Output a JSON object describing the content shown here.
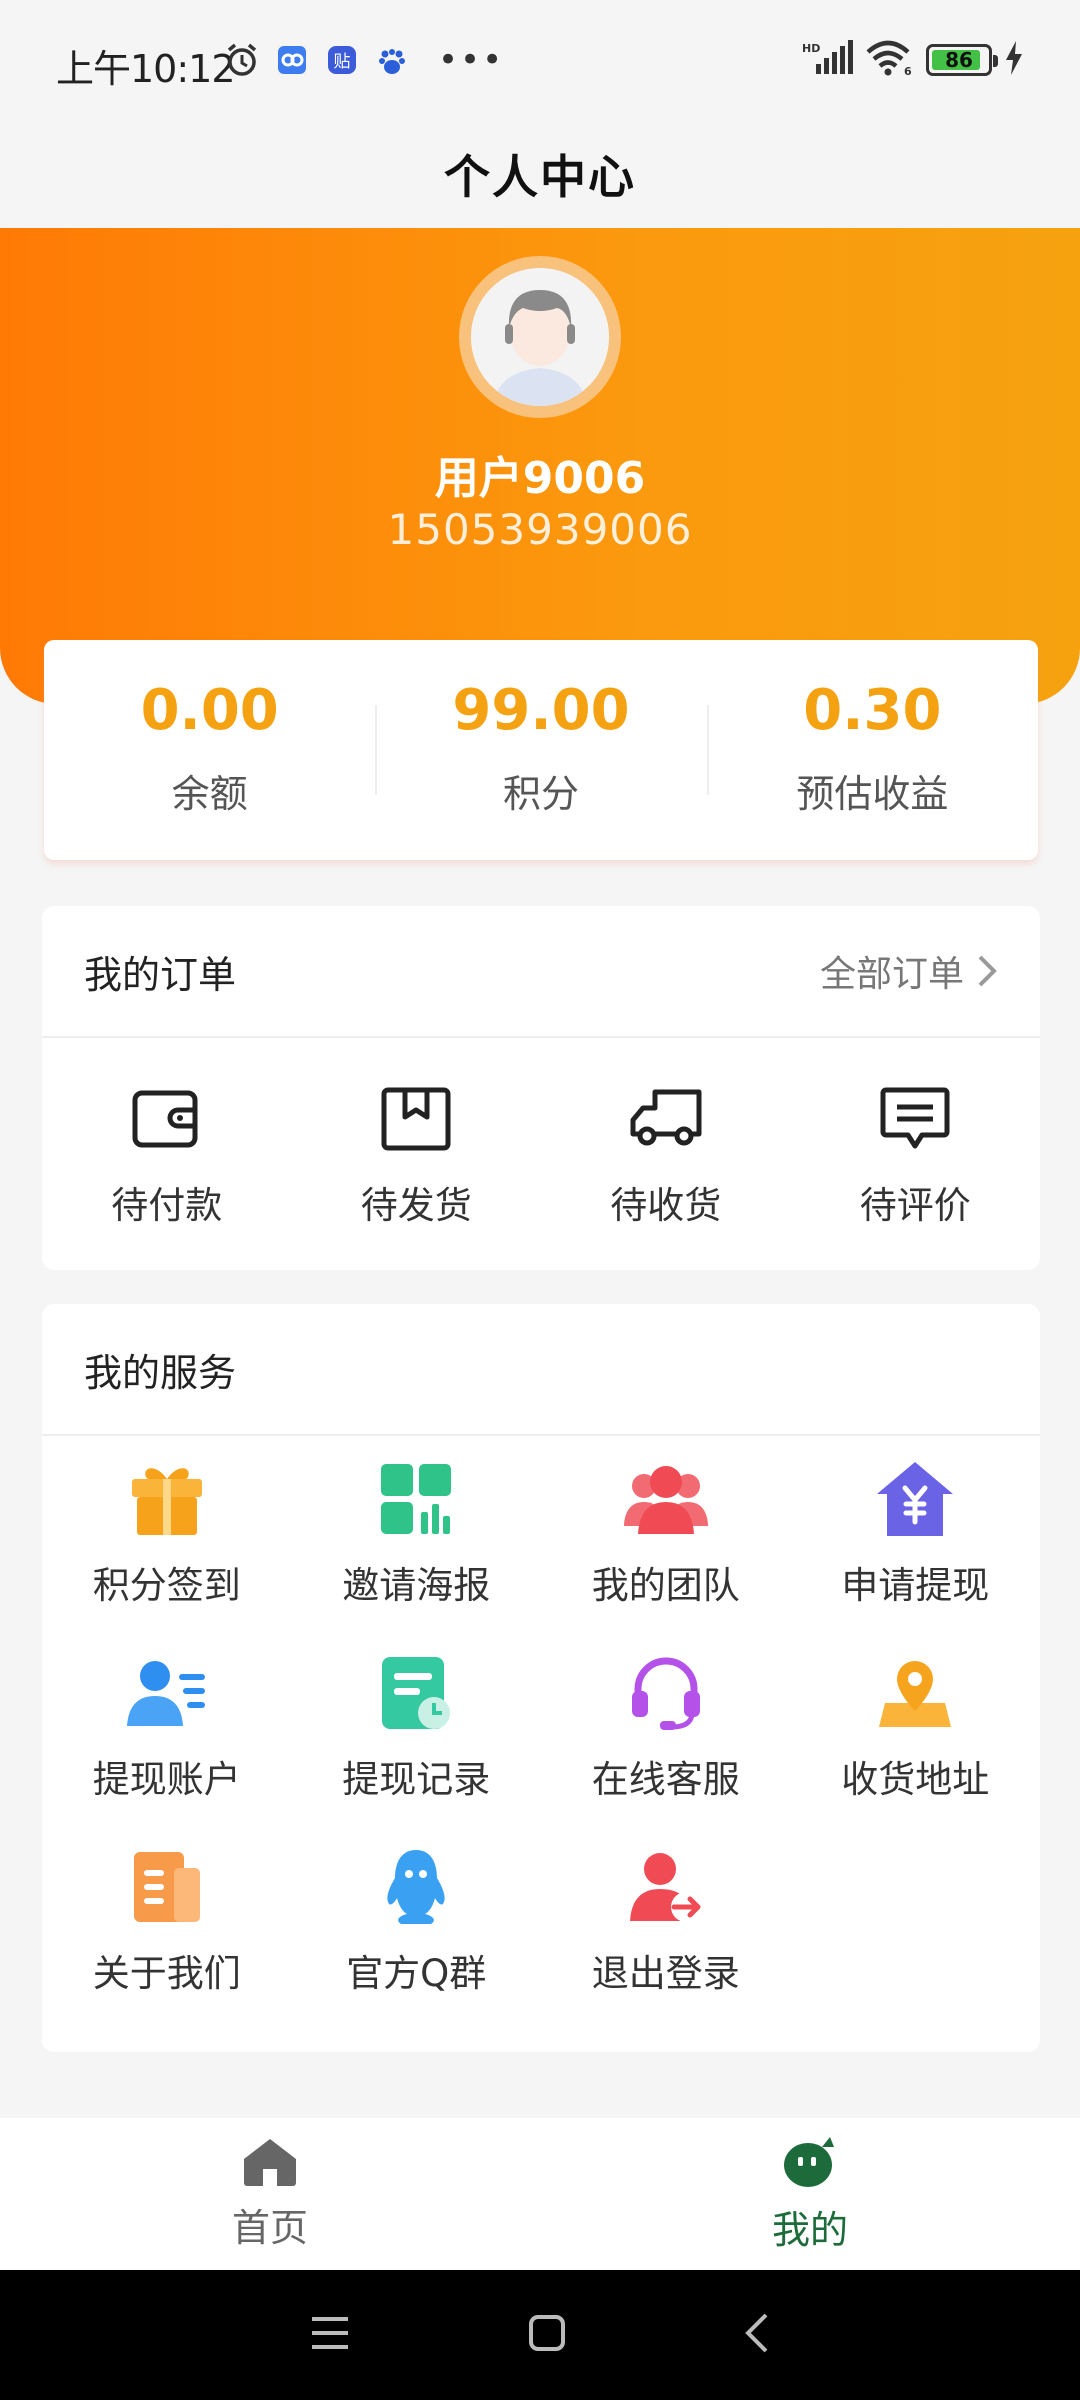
{
  "status_bar": {
    "time": "上午10:12",
    "network": "HD",
    "battery": "86"
  },
  "header": {
    "title": "个人中心"
  },
  "profile": {
    "username": "用户9006",
    "phone": "15053939006"
  },
  "stats": [
    {
      "value": "0.00",
      "label": "余额"
    },
    {
      "value": "99.00",
      "label": "积分"
    },
    {
      "value": "0.30",
      "label": "预估收益"
    }
  ],
  "orders": {
    "title": "我的订单",
    "more": "全部订单",
    "items": [
      {
        "label": "待付款",
        "icon": "wallet-icon"
      },
      {
        "label": "待发货",
        "icon": "package-icon"
      },
      {
        "label": "待收货",
        "icon": "truck-icon"
      },
      {
        "label": "待评价",
        "icon": "comment-icon"
      }
    ]
  },
  "services": {
    "title": "我的服务",
    "items": [
      {
        "label": "积分签到",
        "icon": "gift-icon",
        "color": "#f7a21b"
      },
      {
        "label": "邀请海报",
        "icon": "poster-icon",
        "color": "#2fc38a"
      },
      {
        "label": "我的团队",
        "icon": "team-icon",
        "color": "#f04b55"
      },
      {
        "label": "申请提现",
        "icon": "withdraw-icon",
        "color": "#6b63e6"
      },
      {
        "label": "提现账户",
        "icon": "account-icon",
        "color": "#2f8ff0"
      },
      {
        "label": "提现记录",
        "icon": "record-icon",
        "color": "#35c9a2"
      },
      {
        "label": "在线客服",
        "icon": "headset-icon",
        "color": "#b451e8"
      },
      {
        "label": "收货地址",
        "icon": "location-icon",
        "color": "#f6a41d"
      },
      {
        "label": "关于我们",
        "icon": "about-icon",
        "color": "#f79a4a"
      },
      {
        "label": "官方Q群",
        "icon": "qq-icon",
        "color": "#3aa1f2"
      },
      {
        "label": "退出登录",
        "icon": "logout-icon",
        "color": "#f04b55"
      }
    ]
  },
  "tabbar": {
    "items": [
      {
        "label": "首页",
        "icon": "home-icon",
        "active": false
      },
      {
        "label": "我的",
        "icon": "mine-icon",
        "active": true
      }
    ],
    "active_color": "#1d6b3a",
    "inactive_color": "#666666"
  },
  "colors": {
    "accent": "#f5a212",
    "banner_start": "#ff7a05",
    "banner_end": "#f6a20f"
  }
}
